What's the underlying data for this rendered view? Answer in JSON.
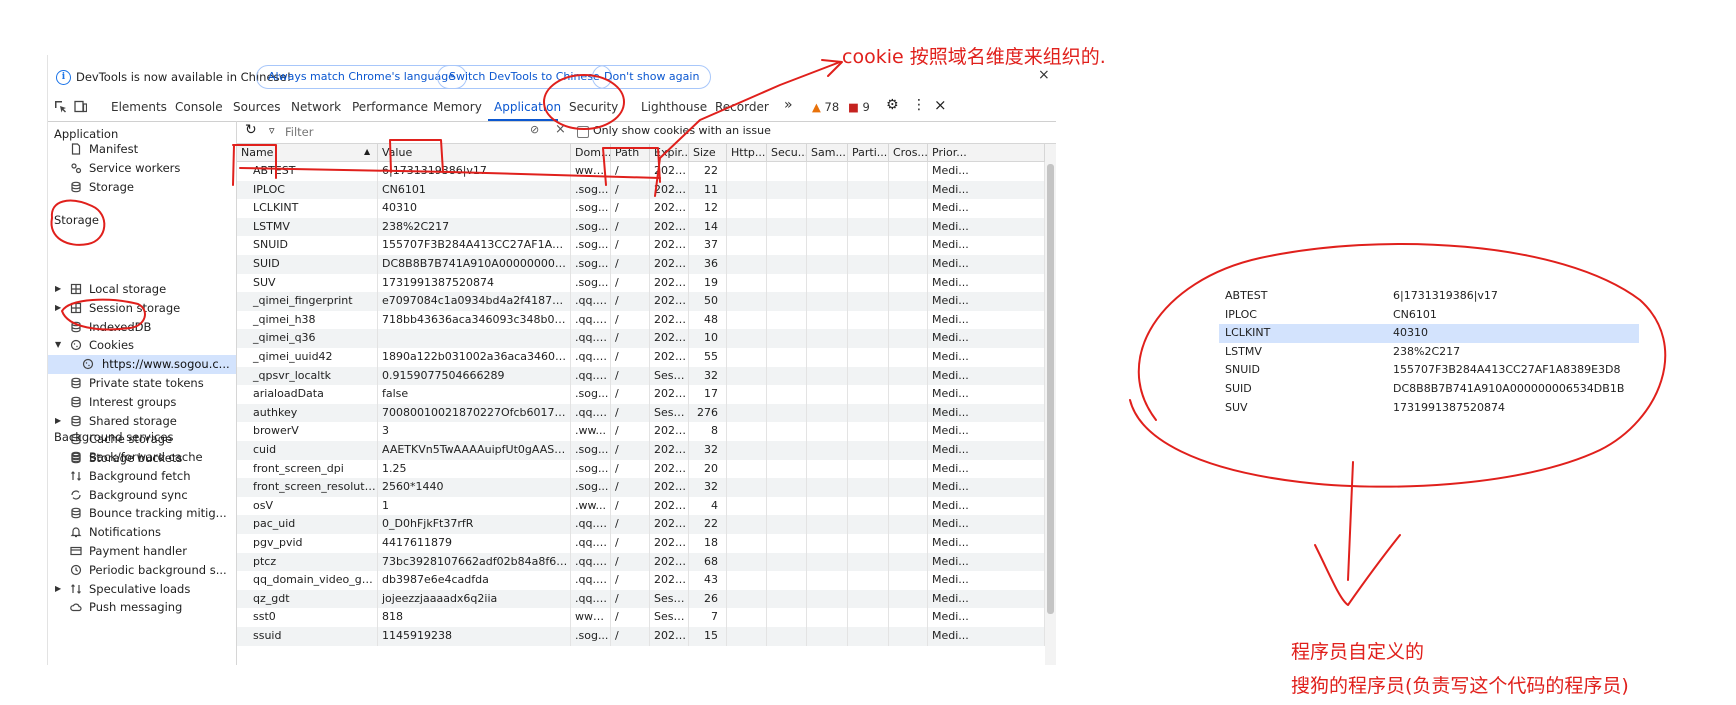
{
  "infobar": {
    "message": "DevTools is now available in Chinese!",
    "btn_match": "Always match Chrome's language",
    "btn_switch": "Switch DevTools to Chinese",
    "btn_dont_show": "Don't show again",
    "close": "×"
  },
  "tabs": [
    "Elements",
    "Console",
    "Sources",
    "Network",
    "Performance",
    "Memory",
    "Application",
    "Security",
    "Lighthouse",
    "Recorder"
  ],
  "active_tab": "Application",
  "tabbar": {
    "more": "»",
    "warnings": "78",
    "issues": "9",
    "close": "×"
  },
  "sidebar": {
    "application_header": "Application",
    "application_items": [
      {
        "label": "Manifest",
        "icon": "document-icon"
      },
      {
        "label": "Service workers",
        "icon": "gears-icon"
      },
      {
        "label": "Storage",
        "icon": "database-icon"
      }
    ],
    "storage_header": "Storage",
    "storage_items": [
      {
        "label": "Local storage",
        "icon": "grid-icon",
        "expandable": true
      },
      {
        "label": "Session storage",
        "icon": "grid-icon",
        "expandable": true
      },
      {
        "label": "IndexedDB",
        "icon": "database-icon"
      },
      {
        "label": "Cookies",
        "icon": "cookie-icon",
        "expanded": true
      },
      {
        "label": "https://www.sogou.c...",
        "icon": "cookie-icon",
        "selected": true,
        "child": true
      },
      {
        "label": "Private state tokens",
        "icon": "database-icon"
      },
      {
        "label": "Interest groups",
        "icon": "database-icon"
      },
      {
        "label": "Shared storage",
        "icon": "database-icon",
        "expandable": true
      },
      {
        "label": "Cache storage",
        "icon": "database-icon"
      },
      {
        "label": "Storage buckets",
        "icon": "database-icon"
      }
    ],
    "background_header": "Background services",
    "background_items": [
      {
        "label": "Back/forward cache",
        "icon": "database-icon"
      },
      {
        "label": "Background fetch",
        "icon": "arrows-icon"
      },
      {
        "label": "Background sync",
        "icon": "sync-icon"
      },
      {
        "label": "Bounce tracking mitig...",
        "icon": "database-icon"
      },
      {
        "label": "Notifications",
        "icon": "bell-icon"
      },
      {
        "label": "Payment handler",
        "icon": "card-icon"
      },
      {
        "label": "Periodic background s...",
        "icon": "clock-icon"
      },
      {
        "label": "Speculative loads",
        "icon": "arrows-icon",
        "expandable": true
      },
      {
        "label": "Push messaging",
        "icon": "cloud-icon"
      }
    ]
  },
  "toolbar": {
    "filter_placeholder": "Filter",
    "only_issue_label": "Only show cookies with an issue"
  },
  "cookie_table": {
    "columns": [
      "Name",
      "Value",
      "Dom...",
      "Path",
      "Expir...",
      "Size",
      "Http...",
      "Secu...",
      "Sam...",
      "Parti...",
      "Cros...",
      "Prior..."
    ],
    "rows": [
      [
        "ABTEST",
        "6|1731319386|v17",
        "www...",
        "/",
        "2024...",
        "22",
        "Medi..."
      ],
      [
        "IPLOC",
        "CN6101",
        ".sog...",
        "/",
        "2025...",
        "11",
        "Medi..."
      ],
      [
        "LCLKINT",
        "40310",
        ".sog...",
        "/",
        "2025...",
        "12",
        "Medi..."
      ],
      [
        "LSTMV",
        "238%2C217",
        ".sog...",
        "/",
        "2025...",
        "14",
        "Medi..."
      ],
      [
        "SNUID",
        "155707F3B284A413CC27AF1A8389E...",
        ".sog...",
        "/",
        "2025...",
        "37",
        "Medi..."
      ],
      [
        "SUID",
        "DC8B8B7B741A910A000000006534...",
        ".sog...",
        "/",
        "2024...",
        "36",
        "Medi..."
      ],
      [
        "SUV",
        "1731991387520874",
        ".sog...",
        "/",
        "2025...",
        "19",
        "Medi..."
      ],
      [
        "_qimei_fingerprint",
        "e7097084c1a0934bd4a2f4187d50db...",
        ".qq.c...",
        "/",
        "2025...",
        "50",
        "Medi..."
      ],
      [
        "_qimei_h38",
        "718bb43636aca346093c348b02000...",
        ".qq.c...",
        "/",
        "2025...",
        "48",
        "Medi..."
      ],
      [
        "_qimei_q36",
        "",
        ".qq.c...",
        "/",
        "2025...",
        "10",
        "Medi..."
      ],
      [
        "_qimei_uuid42",
        "1890a122b031002a36aca346093c34...",
        ".qq.c...",
        "/",
        "2025...",
        "55",
        "Medi..."
      ],
      [
        "_qpsvr_localtk",
        "0.9159077504666289",
        ".qq.c...",
        "/",
        "Sessi...",
        "32",
        "Medi..."
      ],
      [
        "arialoadData",
        "false",
        ".sog...",
        "/",
        "2024...",
        "17",
        "Medi..."
      ],
      [
        "authkey",
        "70080010021870227Ofcb6017e632b...",
        ".qq.c...",
        "/",
        "Sessi...",
        "276",
        "Medi..."
      ],
      [
        "browerV",
        "3",
        ".ww...",
        "/",
        "2024...",
        "8",
        "Medi..."
      ],
      [
        "cuid",
        "AAETKVn5TwAAAAuipfUt0gAASQU=",
        ".sog...",
        "/",
        "2025...",
        "32",
        "Medi..."
      ],
      [
        "front_screen_dpi",
        "1.25",
        ".sog...",
        "/",
        "2025...",
        "20",
        "Medi..."
      ],
      [
        "front_screen_resolution",
        "2560*1440",
        ".sog...",
        "/",
        "2025...",
        "32",
        "Medi..."
      ],
      [
        "osV",
        "1",
        ".ww...",
        "/",
        "2024...",
        "4",
        "Medi..."
      ],
      [
        "pac_uid",
        "0_D0hFjkFt37rfR",
        ".qq.c...",
        "/",
        "2025...",
        "22",
        "Medi..."
      ],
      [
        "pgv_pvid",
        "4417611879",
        ".qq.c...",
        "/",
        "2025...",
        "18",
        "Medi..."
      ],
      [
        "ptcz",
        "73bc3928107662adf02b84a8f690c9...",
        ".qq.c...",
        "/",
        "2025...",
        "68",
        "Medi..."
      ],
      [
        "qq_domain_video_gui...",
        "db3987e6e4cadfda",
        ".qq.c...",
        "/",
        "2025...",
        "43",
        "Medi..."
      ],
      [
        "qz_gdt",
        "jojeezzjaaaadx6q2iia",
        ".qq.c...",
        "/",
        "Sessi...",
        "26",
        "Medi..."
      ],
      [
        "sst0",
        "818",
        "www...",
        "/",
        "Sessi...",
        "7",
        "Medi..."
      ],
      [
        "ssuid",
        "1145919238",
        ".sog...",
        "/",
        "2024...",
        "15",
        "Medi..."
      ]
    ]
  },
  "detail_panel": {
    "rows": [
      [
        "ABTEST",
        "6|1731319386|v17"
      ],
      [
        "IPLOC",
        "CN6101"
      ],
      [
        "LCLKINT",
        "40310"
      ],
      [
        "LSTMV",
        "238%2C217"
      ],
      [
        "SNUID",
        "155707F3B284A413CC27AF1A8389E3D8"
      ],
      [
        "SUID",
        "DC8B8B7B741A910A000000006534DB1B"
      ],
      [
        "SUV",
        "1731991387520874"
      ]
    ],
    "selected_row": 2
  },
  "annotations": {
    "top": "cookie 按照域名维度来组织的.",
    "bottom_line1": "程序员自定义的",
    "bottom_line2": "搜狗的程序员(负责写这个代码的程序员)",
    "color": "#e0201c"
  },
  "colors": {
    "accent": "#0b57d0",
    "selection": "#d3e3fd",
    "warning": "#e8710a",
    "issue": "#c5221f"
  }
}
